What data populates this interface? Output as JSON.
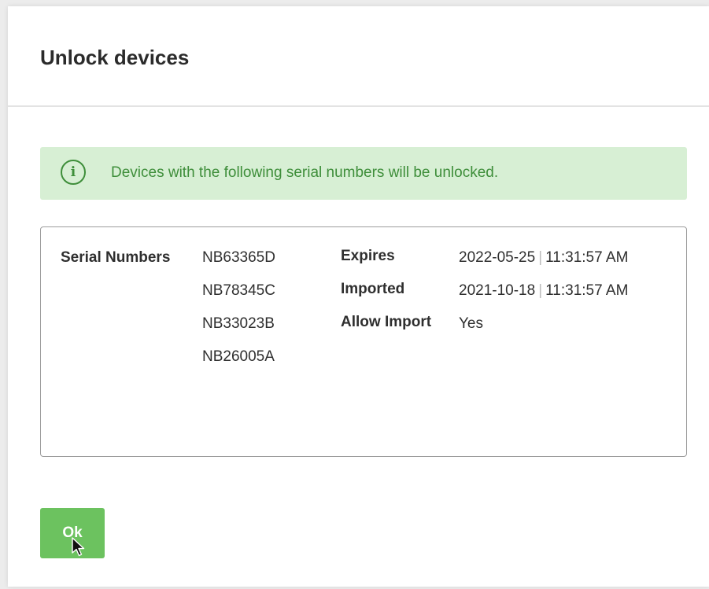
{
  "dialog": {
    "title": "Unlock devices",
    "alert": {
      "icon": "info-icon",
      "glyph": "i",
      "text": "Devices with the following serial numbers will be unlocked."
    },
    "details": {
      "serial_label": "Serial Numbers",
      "serials": [
        "NB63365D",
        "NB78345C",
        "NB33023B",
        "NB26005A"
      ],
      "expires_label": "Expires",
      "expires_date": "2022-05-25",
      "expires_time": "11:31:57 AM",
      "imported_label": "Imported",
      "imported_date": "2021-10-18",
      "imported_time": "11:31:57 AM",
      "allow_import_label": "Allow Import",
      "allow_import_value": "Yes",
      "separator": "|"
    },
    "ok_label": "Ok"
  },
  "colors": {
    "accent_green": "#6cc25f",
    "alert_bg": "#d7efd4",
    "alert_text": "#3e8e3a"
  }
}
